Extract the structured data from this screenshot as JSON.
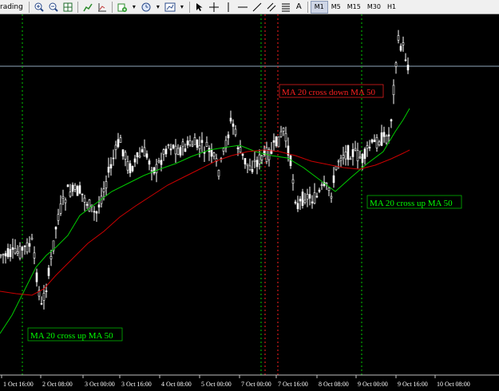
{
  "toolbar": {
    "menu_label": "rading",
    "timeframes": [
      "M1",
      "M5",
      "M15",
      "M30",
      "H1"
    ],
    "active_timeframe": "M1",
    "text_tool_label": "A",
    "icons": [
      "zoom-in-icon",
      "zoom-out-icon",
      "tile-windows-icon",
      "chart-type-icon",
      "indicators-icon",
      "periodicity-icon",
      "templates-icon",
      "cursor-icon",
      "crosshair-icon",
      "vertical-line-icon",
      "horizontal-line-icon",
      "trendline-icon",
      "equidistant-channel-icon",
      "fibonacci-icon"
    ]
  },
  "chart_data": {
    "type": "candlestick",
    "x_ticks": [
      "1 Oct 16:00",
      "2 Oct 08:00",
      "3 Oct 00:00",
      "3 Oct 16:00",
      "4 Oct 08:00",
      "5 Oct 00:00",
      "7 Oct 00:00",
      "7 Oct 16:00",
      "8 Oct 08:00",
      "9 Oct 00:00",
      "9 Oct 16:00",
      "10 Oct 08:00"
    ],
    "annotations": [
      {
        "text": "MA 20 cross up MA 50",
        "color": "#00ff00",
        "at": "1 Oct 16:00"
      },
      {
        "text": "MA 20 cross down MA 50",
        "color": "#ff0000",
        "at": "8 Oct 08:00"
      },
      {
        "text": "MA 20 cross up MA 50",
        "color": "#00ff00",
        "at": "9 Oct 16:00"
      }
    ],
    "series": [
      {
        "name": "MA 20",
        "color": "#00cc00"
      },
      {
        "name": "MA 50",
        "color": "#cc0000"
      }
    ],
    "colors": {
      "background": "#000000",
      "candles": "#ffffff",
      "buy_line": "#8fa9bd",
      "grid": "#000000"
    }
  }
}
